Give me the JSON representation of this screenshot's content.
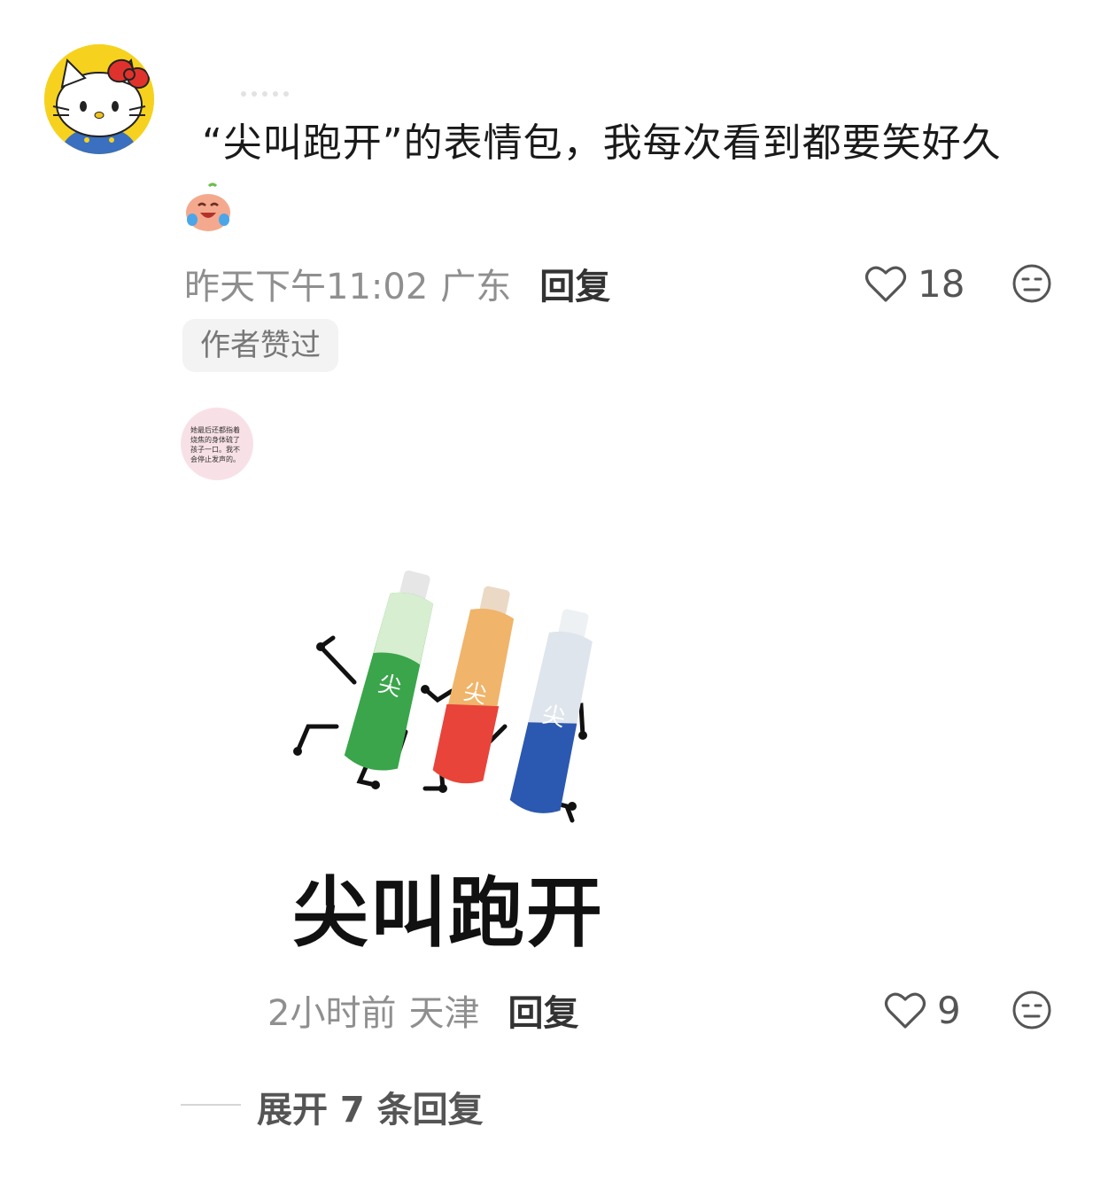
{
  "comment": {
    "text": "“尖叫跑开”的表情包，我每次看到都要笑好久",
    "time": "昨天下午11:02",
    "location": "广东",
    "reply_label": "回复",
    "like_count": "18",
    "author_liked_badge": "作者赞过"
  },
  "reply": {
    "avatar_text": "她最后还都指着烧焦的身体硫了孩子一口。我不会停止发声的。",
    "sticker_caption": "尖叫跑开",
    "time": "2小时前",
    "location": "天津",
    "reply_label": "回复",
    "like_count": "9"
  },
  "expand": {
    "label": "展开 7 条回复"
  },
  "colors": {
    "meta_gray": "#8f8f8f",
    "text_dark": "#1a1a1a",
    "badge_bg": "#f3f3f3",
    "avatar1_bg": "#f6d21f"
  },
  "icons": {
    "like": "heart-outline-icon",
    "dislike": "neutral-face-icon",
    "emoji": "laughing-crying-face-icon"
  }
}
